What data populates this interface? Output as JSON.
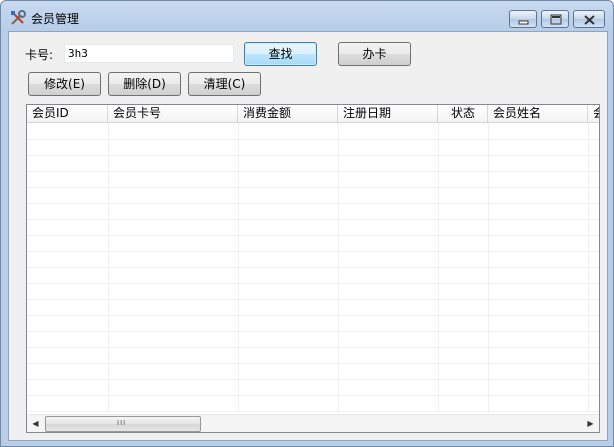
{
  "window": {
    "title": "会员管理",
    "icon": "tools-icon"
  },
  "form": {
    "card_label": "卡号:",
    "card_value": "3h3"
  },
  "buttons": {
    "find": "查找",
    "issue": "办卡",
    "edit": "修改(E)",
    "delete": "删除(D)",
    "clear": "清理(C)"
  },
  "grid": {
    "columns": [
      "会员ID",
      "会员卡号",
      "消费金额",
      "注册日期",
      "状态",
      "会员姓名",
      "会"
    ],
    "rows": []
  },
  "scrollbar": {
    "grip": "III"
  },
  "colors": {
    "title_gradient_top": "#c9daf0",
    "client_bg": "#f0f0f0",
    "focus_button_border": "#3c7fb1"
  }
}
